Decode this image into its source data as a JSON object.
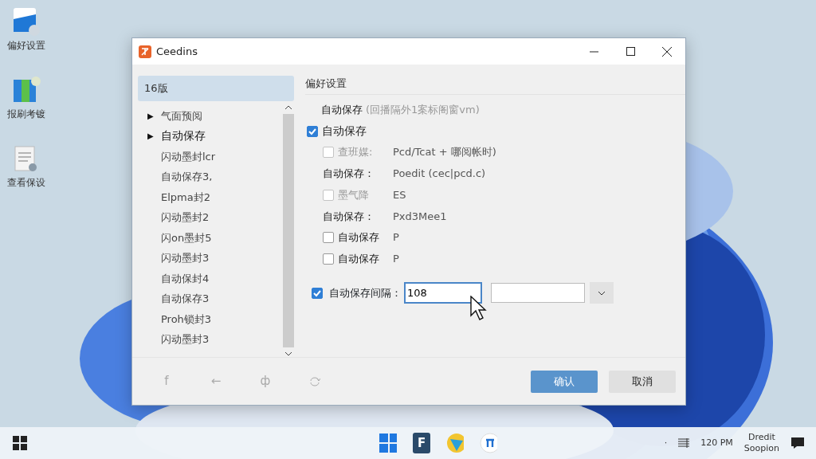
{
  "desktop_icons": [
    {
      "label": "偏好设置",
      "kind": "settings"
    },
    {
      "label": "报刷考镀",
      "kind": "map"
    },
    {
      "label": "查看保设",
      "kind": "document"
    }
  ],
  "window": {
    "title": "Ceedins"
  },
  "sidebar": {
    "header": {
      "label": "16版",
      "selected": true
    },
    "items": [
      {
        "label": "气面预阅",
        "toggle": "▶",
        "strong": false
      },
      {
        "label": "自动保存",
        "toggle": "▶",
        "strong": true
      },
      {
        "label": "闪动墨封lcr"
      },
      {
        "label": "自动保存3,"
      },
      {
        "label": "Elpma封2"
      },
      {
        "label": "闪动墨封2"
      },
      {
        "label": "闪on墨封5"
      },
      {
        "label": "闪动墨封3"
      },
      {
        "label": "自动保封4"
      },
      {
        "label": "自动保存3"
      },
      {
        "label": "Proh锁封3"
      },
      {
        "label": "闪动墨封3"
      }
    ]
  },
  "content": {
    "heading": "偏好设置",
    "rows": [
      {
        "kind": "note",
        "label": "自动保存",
        "hint": "(回播隔外1案标阁窗vm)"
      },
      {
        "kind": "checkbox",
        "label": "自动保存",
        "checked": true,
        "disabled": false,
        "indent": false
      },
      {
        "kind": "checkbox",
        "label": "查班媒:",
        "checked": false,
        "disabled": true,
        "indent": true,
        "value": "Pcd/Tcat +    哪阅帐时)"
      },
      {
        "kind": "field",
        "label": "自动保存：",
        "value": "Poedit (cec|pcd.c)"
      },
      {
        "kind": "checkbox",
        "label": "墨气降",
        "checked": false,
        "disabled": true,
        "indent": true,
        "value": "ES"
      },
      {
        "kind": "field",
        "label": "自动保存：",
        "value": "Pxd3Mee1"
      },
      {
        "kind": "checkbox",
        "label": "自动保存",
        "checked": false,
        "disabled": false,
        "indent": true,
        "value": "P"
      },
      {
        "kind": "checkbox",
        "label": "自动保存",
        "checked": false,
        "disabled": false,
        "indent": true,
        "value": "P"
      }
    ],
    "interval": {
      "label": "自动保存间隔：",
      "checked": true,
      "value": "108"
    }
  },
  "footer": {
    "tool_glyphs": [
      "f",
      "←",
      "ф"
    ],
    "buttons": [
      {
        "label": "确认",
        "kind": "primary"
      },
      {
        "label": "取消",
        "kind": "secondary"
      }
    ]
  },
  "taskbar": {
    "apps": [
      {
        "kind": "windows"
      },
      {
        "kind": "letter",
        "label": "F"
      },
      {
        "kind": "browser"
      },
      {
        "kind": "music"
      }
    ],
    "tray": {
      "dot": "·",
      "clock": "120 PM",
      "line1": "Dredit",
      "line2": "Soopion"
    }
  }
}
